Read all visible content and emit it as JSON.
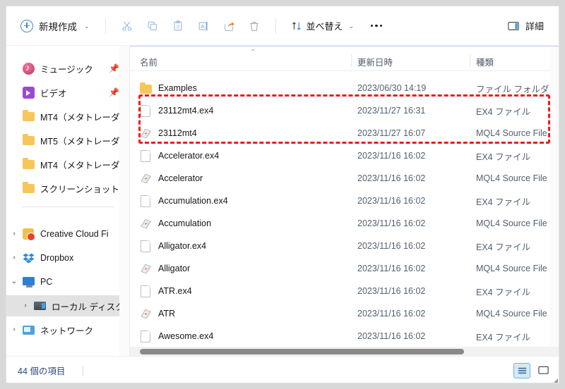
{
  "toolbar": {
    "new_label": "新規作成",
    "new_caret": "⌄",
    "cut_name": "切り取り",
    "copy_name": "コピー",
    "paste_name": "貼り付け",
    "rename_name": "名前の変更",
    "share_name": "共有",
    "delete_name": "削除",
    "sort_label": "並べ替え",
    "sort_caret": "⌄",
    "more_name": "もっと見る",
    "details_label": "詳細"
  },
  "sidebar": {
    "items": [
      {
        "label": "ミュージック",
        "icon": "music-icon",
        "chevron": "",
        "pinned": true,
        "selected": false,
        "indent": 0
      },
      {
        "label": "ビデオ",
        "icon": "video-icon",
        "chevron": "",
        "pinned": true,
        "selected": false,
        "indent": 0
      },
      {
        "label": "MT4（メタトレーダ",
        "icon": "folder-icon",
        "chevron": "",
        "pinned": false,
        "selected": false,
        "indent": 0
      },
      {
        "label": "MT5（メタトレーダ",
        "icon": "folder-icon",
        "chevron": "",
        "pinned": false,
        "selected": false,
        "indent": 0
      },
      {
        "label": "MT4（メタトレーダ",
        "icon": "folder-icon",
        "chevron": "",
        "pinned": false,
        "selected": false,
        "indent": 0
      },
      {
        "label": "スクリーンショット",
        "icon": "folder-icon",
        "chevron": "",
        "pinned": false,
        "selected": false,
        "indent": 0
      },
      {
        "label": "Creative Cloud Fi",
        "icon": "creative-cloud-icon",
        "chevron": "›",
        "pinned": false,
        "selected": false,
        "indent": 0
      },
      {
        "label": "Dropbox",
        "icon": "dropbox-icon",
        "chevron": "›",
        "pinned": false,
        "selected": false,
        "indent": 0
      },
      {
        "label": "PC",
        "icon": "pc-icon",
        "chevron": "⌄",
        "pinned": false,
        "selected": false,
        "indent": 0
      },
      {
        "label": "ローカル ディスク (",
        "icon": "local-disk-icon",
        "chevron": "›",
        "pinned": false,
        "selected": true,
        "indent": 1
      },
      {
        "label": "ネットワーク",
        "icon": "network-icon",
        "chevron": "›",
        "pinned": false,
        "selected": false,
        "indent": 0
      }
    ],
    "pin_glyph": "📌"
  },
  "list": {
    "columns": [
      {
        "label": "名前"
      },
      {
        "label": "更新日時"
      },
      {
        "label": "種類"
      }
    ],
    "sort_indicator": "⌃",
    "rows": [
      {
        "name": "Examples",
        "date": "2023/06/30 14:19",
        "type": "ファイル フォルダー",
        "icon": "folder-icon"
      },
      {
        "name": "23112mt4.ex4",
        "date": "2023/11/27 16:31",
        "type": "EX4 ファイル",
        "icon": "ex4-file-icon"
      },
      {
        "name": "23112mt4",
        "date": "2023/11/27 16:07",
        "type": "MQL4 Source File",
        "icon": "mql4-file-icon"
      },
      {
        "name": "Accelerator.ex4",
        "date": "2023/11/16 16:02",
        "type": "EX4 ファイル",
        "icon": "ex4-file-icon"
      },
      {
        "name": "Accelerator",
        "date": "2023/11/16 16:02",
        "type": "MQL4 Source File",
        "icon": "mql4-file-icon"
      },
      {
        "name": "Accumulation.ex4",
        "date": "2023/11/16 16:02",
        "type": "EX4 ファイル",
        "icon": "ex4-file-icon"
      },
      {
        "name": "Accumulation",
        "date": "2023/11/16 16:02",
        "type": "MQL4 Source File",
        "icon": "mql4-file-icon"
      },
      {
        "name": "Alligator.ex4",
        "date": "2023/11/16 16:02",
        "type": "EX4 ファイル",
        "icon": "ex4-file-icon"
      },
      {
        "name": "Alligator",
        "date": "2023/11/16 16:02",
        "type": "MQL4 Source File",
        "icon": "mql4-file-icon"
      },
      {
        "name": "ATR.ex4",
        "date": "2023/11/16 16:02",
        "type": "EX4 ファイル",
        "icon": "ex4-file-icon"
      },
      {
        "name": "ATR",
        "date": "2023/11/16 16:02",
        "type": "MQL4 Source File",
        "icon": "mql4-file-icon"
      },
      {
        "name": "Awesome.ex4",
        "date": "2023/11/16 16:02",
        "type": "EX4 ファイル",
        "icon": "ex4-file-icon"
      }
    ]
  },
  "statusbar": {
    "item_count": "44 個の項目",
    "details_view_name": "詳細表示",
    "preview_pane_name": "プレビュー ウィンドウ"
  },
  "annotation": {
    "color": "#f01b1b",
    "highlights_rows": [
      "23112mt4.ex4",
      "23112mt4"
    ]
  }
}
